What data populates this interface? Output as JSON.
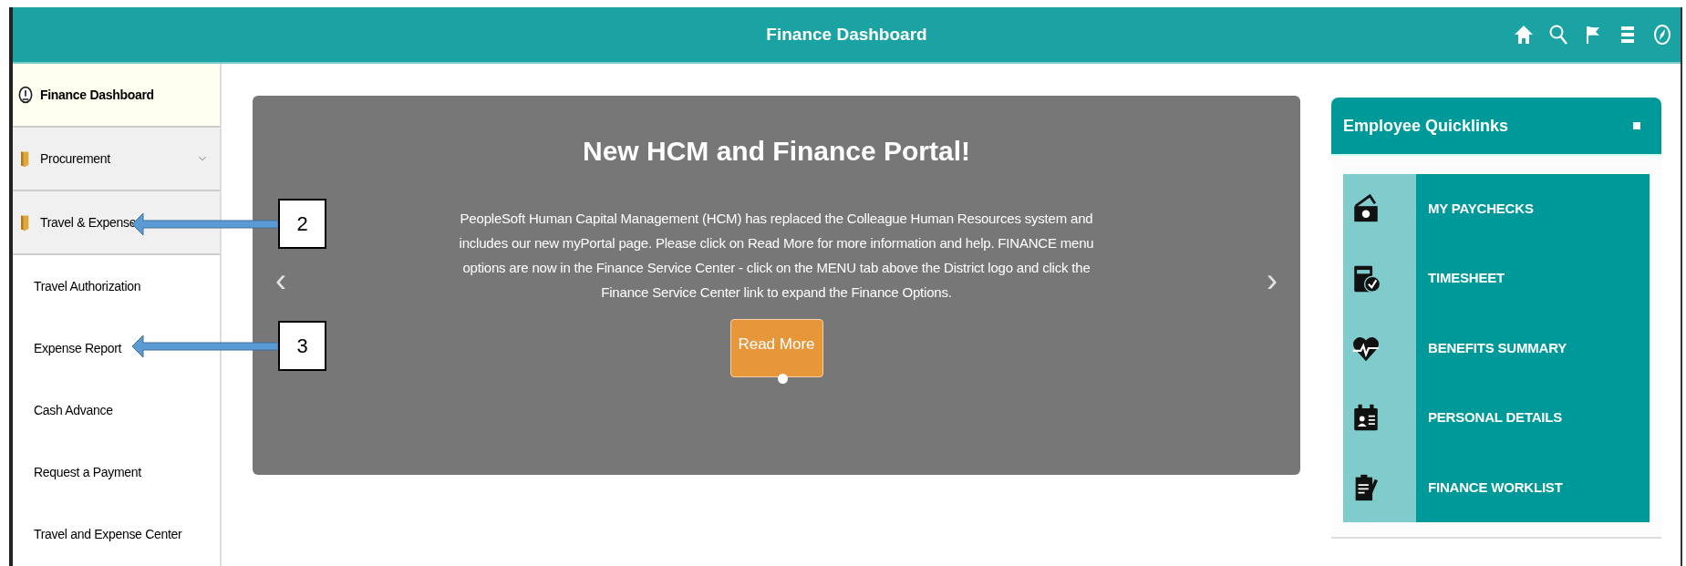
{
  "header": {
    "title": "Finance Dashboard"
  },
  "sidebar": {
    "items": [
      {
        "label": "Finance Dashboard",
        "kind": "home",
        "selected": true
      },
      {
        "label": "Procurement",
        "kind": "folder",
        "expanded": false,
        "selected": false
      },
      {
        "label": "Travel & Expense",
        "kind": "folder",
        "expanded": true,
        "selected": false,
        "children": [
          {
            "label": "Travel Authorization"
          },
          {
            "label": "Expense Report"
          },
          {
            "label": "Cash Advance"
          },
          {
            "label": "Request a Payment"
          },
          {
            "label": "Travel and Expense Center"
          }
        ]
      }
    ]
  },
  "carousel": {
    "title": "New HCM and Finance Portal!",
    "body": "PeopleSoft Human Capital Management (HCM) has replaced the Colleague Human Resources system and includes our new myPortal page. Please click on Read More for more information and help. FINANCE menu options are now in the Finance Service Center - click on the MENU tab above the District logo and click the Finance Service Center link to expand the Finance Options.",
    "button": "Read More",
    "prev": "‹",
    "next": "›"
  },
  "quicklinks": {
    "title": "Employee Quicklinks",
    "links": [
      {
        "label": "MY PAYCHECKS",
        "kind": "money"
      },
      {
        "label": "TIMESHEET",
        "kind": "timesheet"
      },
      {
        "label": "BENEFITS SUMMARY",
        "kind": "heart"
      },
      {
        "label": "PERSONAL DETAILS",
        "kind": "badge"
      },
      {
        "label": "FINANCE WORKLIST",
        "kind": "clipboard"
      }
    ]
  },
  "callouts": [
    {
      "label": "2"
    },
    {
      "label": "3"
    }
  ]
}
